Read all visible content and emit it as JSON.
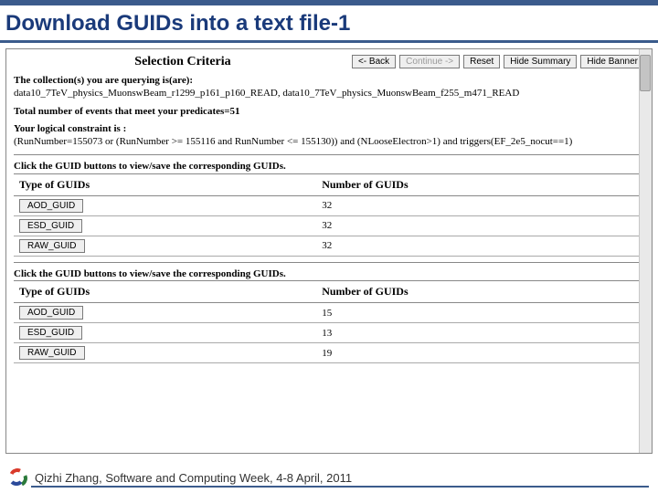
{
  "slide": {
    "title": "Download GUIDs into a text file-1"
  },
  "panel": {
    "heading": "Selection Criteria",
    "buttons": {
      "back": "<- Back",
      "continue": "Continue ->",
      "reset": "Reset",
      "hide_summary": "Hide Summary",
      "hide_banner": "Hide Banner"
    },
    "collections_label": "The collection(s) you are querying is(are):",
    "collections_value": "data10_7TeV_physics_MuonswBeam_r1299_p161_p160_READ, data10_7TeV_physics_MuonswBeam_f255_m471_READ",
    "total_label": "Total number of events that meet your predicates=51",
    "constraint_label": "Your logical constraint is :",
    "constraint_value": "(RunNumber=155073 or (RunNumber >= 155116 and RunNumber <= 155130)) and (NLooseElectron>1) and triggers(EF_2e5_nocut==1)",
    "click_hint": "Click the GUID buttons to view/save the corresponding GUIDs.",
    "col_type": "Type of GUIDs",
    "col_number": "Number of GUIDs",
    "set1": [
      {
        "type": "AOD_GUID",
        "count": "32"
      },
      {
        "type": "ESD_GUID",
        "count": "32"
      },
      {
        "type": "RAW_GUID",
        "count": "32"
      }
    ],
    "set2": [
      {
        "type": "AOD_GUID",
        "count": "15"
      },
      {
        "type": "ESD_GUID",
        "count": "13"
      },
      {
        "type": "RAW_GUID",
        "count": "19"
      }
    ]
  },
  "footer": {
    "text": "Qizhi Zhang, Software and Computing Week, 4-8 April, 2011"
  }
}
